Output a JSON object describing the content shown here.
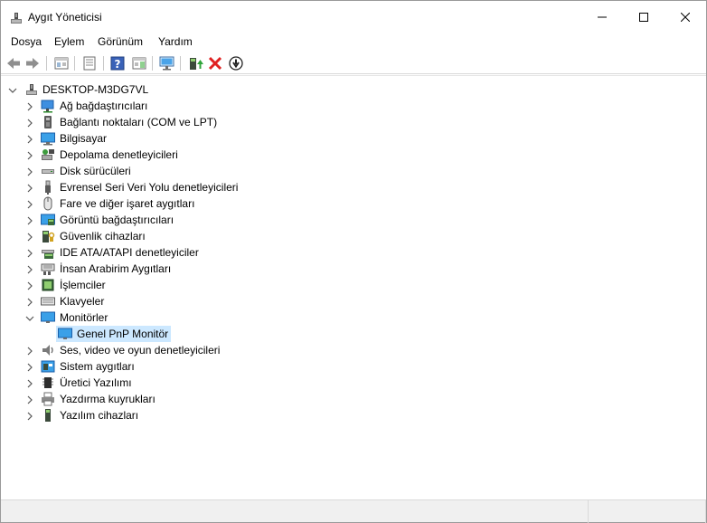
{
  "window": {
    "title": "Aygıt Yöneticisi"
  },
  "menu": [
    "Dosya",
    "Eylem",
    "Görünüm",
    "Yardım"
  ],
  "toolbar": {
    "buttons": [
      "back-arrow-icon",
      "forward-arrow-icon",
      "show-hide-console-tree-icon",
      "properties-icon",
      "help-icon",
      "action-pane-icon",
      "scan-hardware-icon",
      "update-driver-icon",
      "uninstall-device-icon",
      "disable-device-icon"
    ]
  },
  "tree": {
    "root": "DESKTOP-M3DG7VL",
    "categories": [
      "Ağ bağdaştırıcıları",
      "Bağlantı noktaları (COM ve LPT)",
      "Bilgisayar",
      "Depolama denetleyicileri",
      "Disk sürücüleri",
      "Evrensel Seri Veri Yolu denetleyicileri",
      "Fare ve diğer işaret aygıtları",
      "Görüntü bağdaştırıcıları",
      "Güvenlik cihazları",
      "IDE ATA/ATAPI denetleyiciler",
      "İnsan Arabirim Aygıtları",
      "İşlemciler",
      "Klavyeler",
      "Monitörler",
      "Ses, video ve oyun denetleyicileri",
      "Sistem aygıtları",
      "Üretici Yazılımı",
      "Yazdırma kuyrukları",
      "Yazılım cihazları"
    ],
    "expanded_child": "Genel PnP Monitör"
  },
  "colors": {
    "selection": "#cce8ff",
    "accent": "#0078d7"
  }
}
